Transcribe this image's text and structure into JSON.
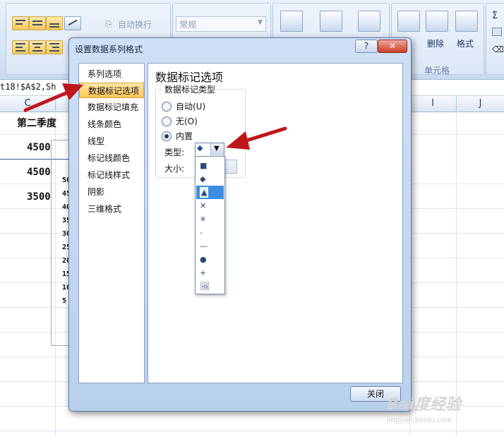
{
  "ribbon": {
    "wrap_text_label": "自动换行",
    "number_format_value": "常规",
    "delete_label": "删除",
    "format_label": "格式",
    "cells_group_label": "单元格",
    "sigma_label": "Σ"
  },
  "formula_bar": {
    "text": "t18!$A$2,Sh"
  },
  "sheet": {
    "columns": [
      "C",
      "I",
      "J"
    ],
    "header_cell": "第二季度",
    "values": [
      "4500",
      "4500",
      "3500"
    ],
    "chart_axis_labels": [
      "50",
      "45",
      "40",
      "35",
      "30",
      "25",
      "20",
      "15",
      "10",
      "5"
    ]
  },
  "dialog": {
    "title": "设置数据系列格式",
    "help_label": "?",
    "close_label": "✕",
    "nav_items": [
      "系列选项",
      "数据标记选项",
      "数据标记填充",
      "线条颜色",
      "线型",
      "标记线颜色",
      "标记线样式",
      "阴影",
      "三维格式"
    ],
    "selected_nav_index": 1,
    "section_title": "数据标记选项",
    "group_title": "数据标记类型",
    "radio_options": [
      "自动(U)",
      "无(O)",
      "内置"
    ],
    "selected_radio_index": 2,
    "type_label": "类型:",
    "size_label": "大小:",
    "close_button": "关闭"
  },
  "dropdown": {
    "selected_symbol": "◆",
    "options": [
      "■",
      "◆",
      "▲",
      "✕",
      "✳",
      "-",
      "—",
      "●",
      "+",
      "🖼"
    ],
    "highlighted_index": 2
  },
  "watermark": {
    "text": "Bai度经验",
    "subtext": "jingyan.baidu.com"
  },
  "colors": {
    "accent_arrow": "#c0161b",
    "selection": "#ffc65a",
    "highlight": "#3d8ede"
  }
}
